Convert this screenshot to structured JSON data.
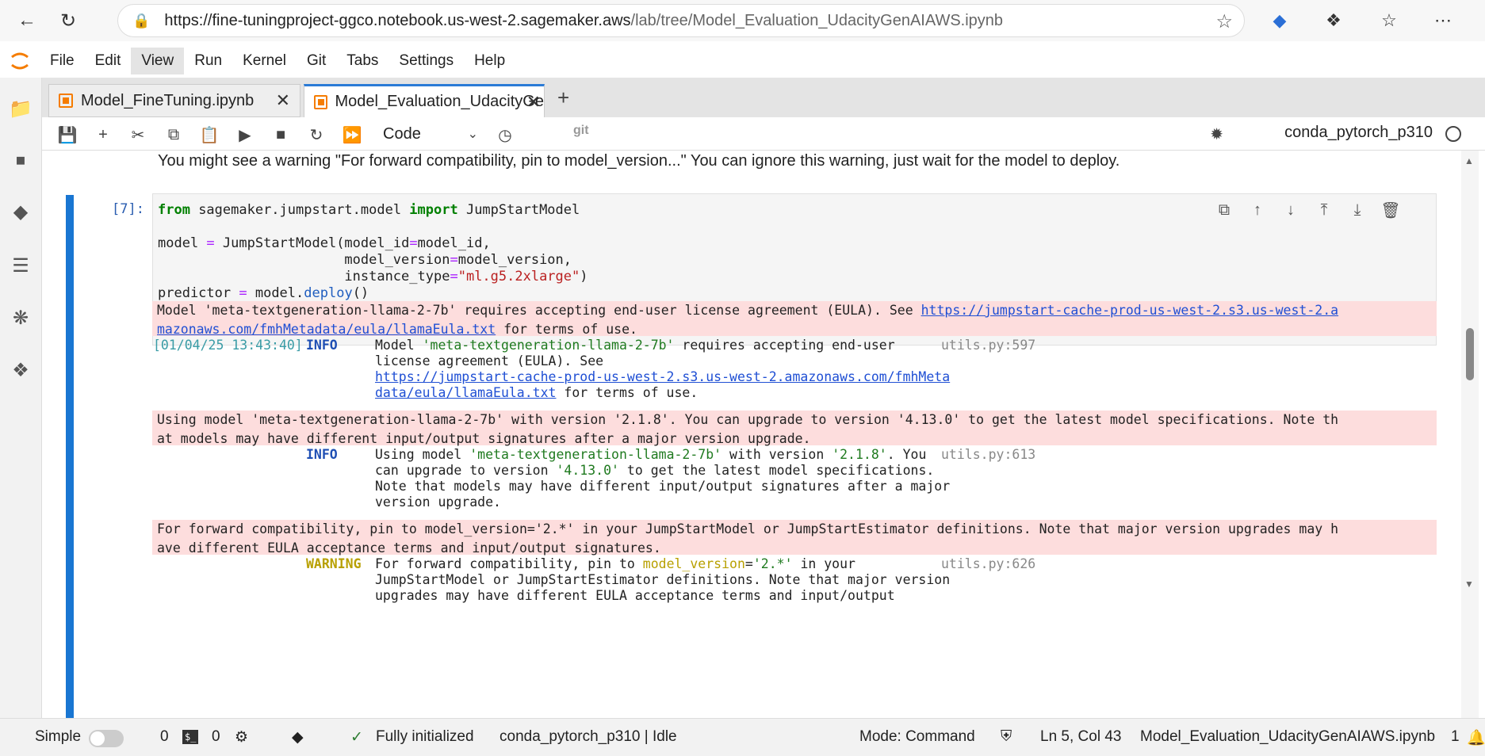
{
  "browser": {
    "url_host": "https://fine-tuningproject-ggco.notebook.us-west-2.sagemaker.aws",
    "url_path": "/lab/tree/Model_Evaluation_UdacityGenAIAWS.ipynb"
  },
  "menu": [
    "File",
    "Edit",
    "View",
    "Run",
    "Kernel",
    "Git",
    "Tabs",
    "Settings",
    "Help"
  ],
  "tabs": [
    {
      "label": "Model_FineTuning.ipynb"
    },
    {
      "label": "Model_Evaluation_UdacityGe"
    }
  ],
  "toolbar": {
    "cell_type": "Code",
    "git": "git",
    "kernel": "conda_pytorch_p310"
  },
  "notebook": {
    "markdown_text": "You might see a warning \"For forward compatibility, pin to model_version...\" You can ignore this warning, just wait for the model to deploy.",
    "prompt": "[7]:",
    "code": {
      "l1_kw1": "from",
      "l1_mod": " sagemaker.jumpstart.model ",
      "l1_kw2": "import",
      "l1_cls": " JumpStartModel",
      "l3_a": "model ",
      "l3_op": "=",
      "l3_b": " JumpStartModel(model_id",
      "l3_op2": "=",
      "l3_c": "model_id,",
      "l4_a": "                       model_version",
      "l4_op": "=",
      "l4_b": "model_version,",
      "l5_a": "                       instance_type",
      "l5_op": "=",
      "l5_str": "\"ml.g5.2xlarge\"",
      "l5_b": ")",
      "l6_a": "predictor ",
      "l6_op": "=",
      "l6_b": " model.",
      "l6_fn": "deploy",
      "l6_c": "()"
    },
    "outputs": {
      "err1_l1": "Model 'meta-textgeneration-llama-2-7b' requires accepting end-user license agreement (EULA). See ",
      "err1_link1": "https://jumpstart-cache-prod-us-west-2.s3.us-west-2.a",
      "err1_link2": "mazonaws.com/fmhMetadata/eula/llamaEula.txt",
      "err1_l2b": " for terms of use.",
      "log1_ts": "[01/04/25 13:43:40]",
      "log1_level": "INFO",
      "log1_a": "Model ",
      "log1_green": "'meta-textgeneration-llama-2-7b'",
      "log1_b": " requires accepting end-user",
      "log1_src": "utils.py:597",
      "log1_l2": "license agreement (EULA). See",
      "log1_link1": "https://jumpstart-cache-prod-us-west-2.s3.us-west-2.amazonaws.com/fmhMeta",
      "log1_link2": "data/eula/llamaEula.txt",
      "log1_l4b": " for terms of use.",
      "err2_l1": "Using model 'meta-textgeneration-llama-2-7b' with version '2.1.8'. You can upgrade to version '4.13.0' to get the latest model specifications. Note th",
      "err2_l2": "at models may have different input/output signatures after a major version upgrade.",
      "log2_level": "INFO",
      "log2_a": "Using model ",
      "log2_green1": "'meta-textgeneration-llama-2-7b'",
      "log2_b": " with version ",
      "log2_green2": "'2.1.8'",
      "log2_c": ". You",
      "log2_src": "utils.py:613",
      "log2_l2a": "can upgrade to version ",
      "log2_green3": "'4.13.0'",
      "log2_l2b": " to get the latest model specifications.",
      "log2_l3": "Note that models may have different input/output signatures after a major",
      "log2_l4": "version upgrade.",
      "err3_l1": "For forward compatibility, pin to model_version='2.*' in your JumpStartModel or JumpStartEstimator definitions. Note that major version upgrades may h",
      "err3_l2": "ave different EULA acceptance terms and input/output signatures.",
      "log3_level": "WARNING",
      "log3_a": "For forward compatibility, pin to ",
      "log3_yellow": "model_version",
      "log3_eq": "=",
      "log3_green": "'2.*'",
      "log3_b": " in your",
      "log3_src": "utils.py:626",
      "log3_l2": "JumpStartModel or JumpStartEstimator definitions. Note that major version",
      "log3_l3": "upgrades may have different EULA acceptance terms and input/output"
    }
  },
  "statusbar": {
    "simple": "Simple",
    "count1": "0",
    "terminal_icon": "$_",
    "count2": "0",
    "status": "Fully initialized",
    "kernel_status": "conda_pytorch_p310 | Idle",
    "mode": "Mode: Command",
    "position": "Ln 5, Col 43",
    "filename": "Model_Evaluation_UdacityGenAIAWS.ipynb",
    "page": "1"
  },
  "colors": {
    "accent": "#1976d2",
    "error_bg": "#fddddd",
    "jupyter_orange": "#f57c00"
  }
}
